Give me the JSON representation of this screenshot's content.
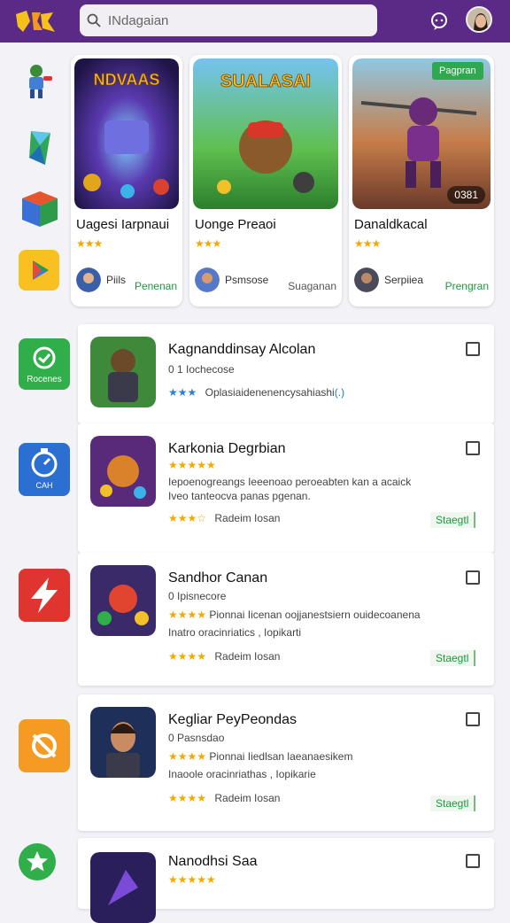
{
  "header": {
    "search_placeholder": "INdagaian",
    "brand_color": "#5b2a86"
  },
  "featured": [
    {
      "art_title": "NDVAAS",
      "title": "Uagesi Iarpnaui",
      "stars": "★★★",
      "publisher": "Piils",
      "action": "Penenan",
      "badge": "",
      "duration": ""
    },
    {
      "art_title": "SUALASAI",
      "title": "Uonge Preaoi",
      "stars": "★★★",
      "publisher": "Psmsose",
      "action": "Suaganan",
      "badge": "",
      "duration": ""
    },
    {
      "art_title": "",
      "title": "Danaldkacal",
      "stars": "★★★",
      "publisher": "Serpiiea",
      "action": "Prengran",
      "badge": "Pagpran",
      "duration": "0381"
    }
  ],
  "rail": [
    {
      "name": "avatar-figure",
      "label": ""
    },
    {
      "name": "crystal",
      "label": ""
    },
    {
      "name": "cube",
      "label": ""
    },
    {
      "name": "play-store",
      "label": ""
    },
    {
      "name": "recentes",
      "label": "Rocenes"
    },
    {
      "name": "timer",
      "label": "CAH"
    },
    {
      "name": "bolt",
      "label": ""
    },
    {
      "name": "puzzle",
      "label": ""
    },
    {
      "name": "star",
      "label": ""
    }
  ],
  "list": [
    {
      "name": "Kagnanddinsay Alcolan",
      "sub": "0 1  Iochecose",
      "desc1": "",
      "desc2": "",
      "stars": "★★★",
      "meta": "Oplasiaidenenencysahiashi",
      "meta_link": "(.)",
      "action": ""
    },
    {
      "name": "Karkonia Degrbian",
      "sub": "★★★★★",
      "desc1": "Iepoenogreangs Ieeenoao peroeabten kan a acaick",
      "desc2": "Iveo tanteocva panas  pgenan.",
      "stars": "★★★☆",
      "meta": "Radeim Iosan",
      "meta_link": "",
      "action": "Staegtl"
    },
    {
      "name": "Sandhor Canan",
      "sub": "0 Ipisnecore",
      "desc1": "Pionnai Iicenan oojjanestsiern  ouidecoanena",
      "desc2": "Inatro oracinriatics , Iopikarti",
      "stars": "★★★★",
      "meta": "Radeim Iosan",
      "meta_link": "",
      "action": "Staegtl"
    },
    {
      "name": "Kegliar PeyPeondas",
      "sub": "0 Pasnsdao",
      "desc1": "Pionnai Iiedlsan laeanaesikem",
      "desc2": "Inaoole oracinriathas , Iopikarie",
      "stars": "★★★★",
      "meta": "Radeim Iosan",
      "meta_link": "",
      "action": "Staegtl"
    },
    {
      "name": "Nanodhsi Saa",
      "sub": "★★★★★",
      "desc1": "",
      "desc2": "",
      "stars": "",
      "meta": "",
      "meta_link": "",
      "action": ""
    }
  ]
}
